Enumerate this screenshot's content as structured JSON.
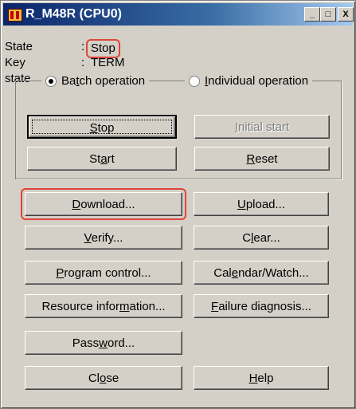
{
  "window": {
    "title": "R_M48R (CPU0)",
    "controls": {
      "minimize": "_",
      "maximize": "□",
      "close": "X"
    }
  },
  "status": {
    "state_label": "State",
    "colon": ":",
    "state_value": "Stop",
    "key_state_label": "Key state",
    "key_state_value": "TERM"
  },
  "operation": {
    "batch": {
      "pre": "Ba",
      "key": "t",
      "post": "ch operation",
      "selected": true
    },
    "individual": {
      "pre": "",
      "key": "I",
      "post": "ndividual operation",
      "selected": false
    },
    "stop": {
      "pre": "",
      "key": "S",
      "post": "top"
    },
    "initial_start": {
      "pre": "",
      "key": "I",
      "post": "nitial start",
      "enabled": false
    },
    "start": {
      "pre": "St",
      "key": "a",
      "post": "rt"
    },
    "reset": {
      "pre": "",
      "key": "R",
      "post": "eset"
    }
  },
  "buttons": {
    "download": {
      "pre": "",
      "key": "D",
      "post": "ownload..."
    },
    "upload": {
      "pre": "",
      "key": "U",
      "post": "pload..."
    },
    "verify": {
      "pre": "",
      "key": "V",
      "post": "erify..."
    },
    "clear": {
      "pre": "C",
      "key": "l",
      "post": "ear..."
    },
    "program_control": {
      "pre": "",
      "key": "P",
      "post": "rogram control..."
    },
    "calendar_watch": {
      "pre": "Cal",
      "key": "e",
      "post": "ndar/Watch..."
    },
    "resource_info": {
      "pre": "Resource infor",
      "key": "m",
      "post": "ation..."
    },
    "failure_diag": {
      "pre": "",
      "key": "F",
      "post": "ailure diagnosis..."
    },
    "password": {
      "pre": "Pass",
      "key": "w",
      "post": "ord..."
    },
    "close": {
      "pre": "Cl",
      "key": "o",
      "post": "se"
    },
    "help": {
      "pre": "",
      "key": "H",
      "post": "elp"
    }
  },
  "colors": {
    "highlight": "#e0453a",
    "face": "#d4d0c8",
    "title_start": "#0a246a"
  }
}
